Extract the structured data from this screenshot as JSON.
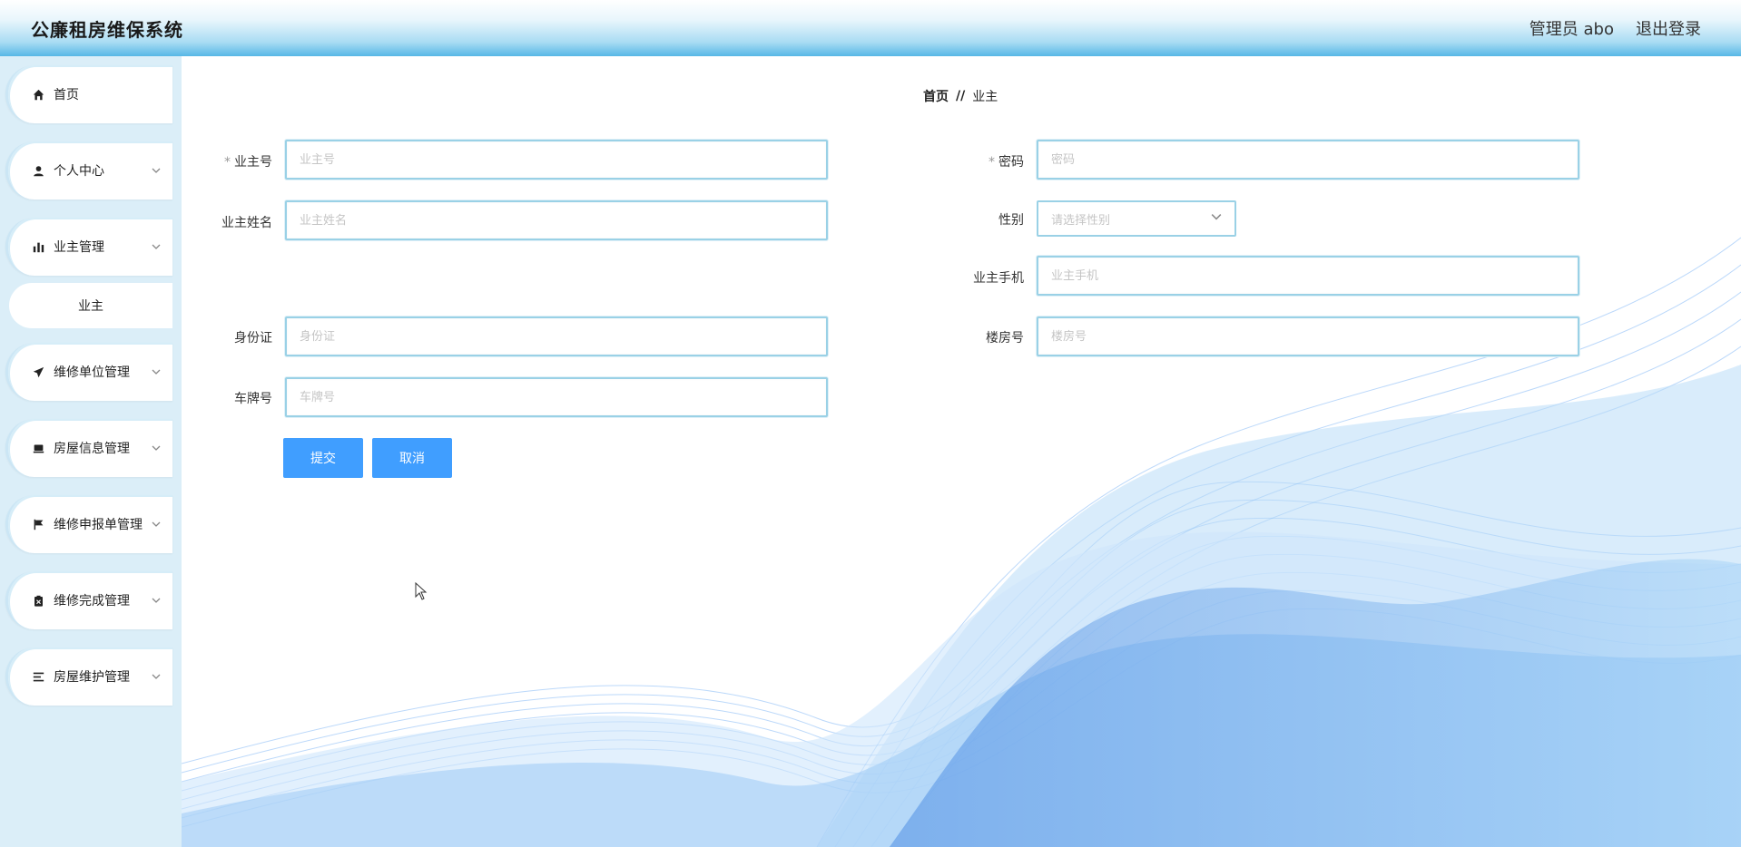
{
  "header": {
    "title": "公廉租房维保系统",
    "user_label": "管理员 abo",
    "logout_label": "退出登录"
  },
  "sidebar": {
    "items": [
      {
        "label": "首页",
        "icon": "home-icon"
      },
      {
        "label": "个人中心",
        "icon": "user-icon"
      },
      {
        "label": "业主管理",
        "icon": "bar-chart-icon"
      },
      {
        "label": "维修单位管理",
        "icon": "send-icon"
      },
      {
        "label": "房屋信息管理",
        "icon": "inbox-icon"
      },
      {
        "label": "维修申报单管理",
        "icon": "flag-icon"
      },
      {
        "label": "维修完成管理",
        "icon": "clipboard-icon"
      },
      {
        "label": "房屋维护管理",
        "icon": "list-icon"
      }
    ],
    "submenu": {
      "label": "业主"
    }
  },
  "breadcrumb": {
    "home": "首页",
    "separator": "//",
    "current": "业主"
  },
  "form": {
    "owner_no": {
      "label": "业主号",
      "required": "*",
      "placeholder": "业主号"
    },
    "password": {
      "label": "密码",
      "required": "*",
      "placeholder": "密码"
    },
    "owner_name": {
      "label": "业主姓名",
      "placeholder": "业主姓名"
    },
    "gender": {
      "label": "性别",
      "placeholder": "请选择性别"
    },
    "phone": {
      "label": "业主手机",
      "placeholder": "业主手机"
    },
    "id_card": {
      "label": "身份证",
      "placeholder": "身份证"
    },
    "building_no": {
      "label": "楼房号",
      "placeholder": "楼房号"
    },
    "plate_no": {
      "label": "车牌号",
      "placeholder": "车牌号"
    },
    "submit_label": "提交",
    "cancel_label": "取消"
  },
  "colors": {
    "primary_button": "#409eff",
    "sidebar_bg": "#dbeef8",
    "input_border": "#9ad1e6",
    "header_gradient_end": "#57b7e6"
  }
}
